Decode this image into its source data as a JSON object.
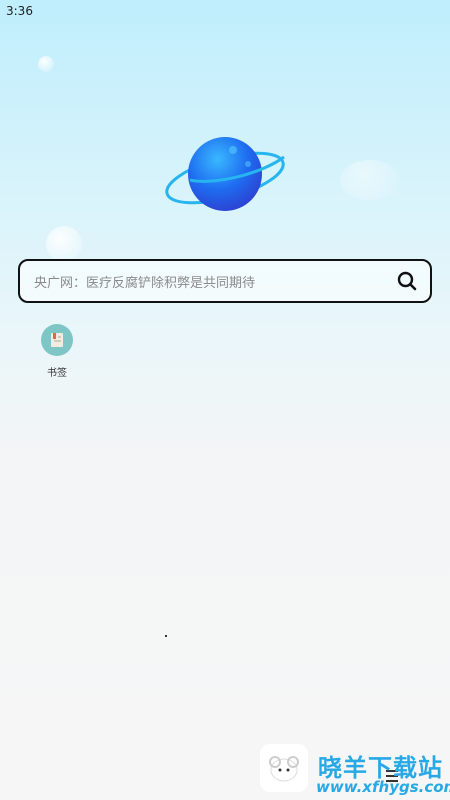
{
  "status_bar": {
    "time": "3:36"
  },
  "search": {
    "placeholder": "央广网：医疗反腐铲除积弊是共同期待"
  },
  "shortcuts": [
    {
      "label": "书签",
      "icon": "bookmark-icon"
    }
  ],
  "watermark": {
    "title": "晓羊下载站",
    "url": "www.xfhygs.com"
  },
  "colors": {
    "accent": "#28a9e6",
    "planet": "#1e6cf0",
    "shortcut_bg": "#7ec6c6"
  }
}
